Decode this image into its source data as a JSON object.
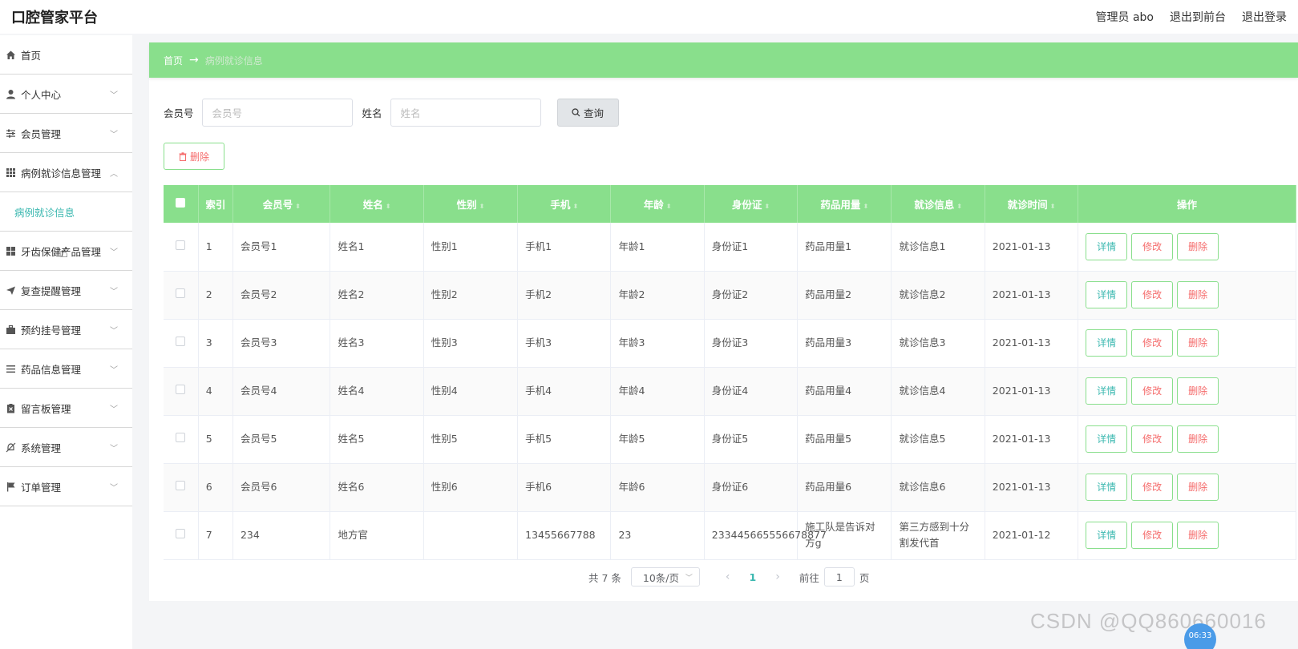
{
  "header": {
    "brand": "口腔管家平台",
    "user": "管理员 abo",
    "to_front": "退出到前台",
    "logout": "退出登录"
  },
  "sidebar": {
    "items": [
      {
        "label": "首页",
        "icon": "home-icon"
      },
      {
        "label": "个人中心",
        "icon": "user-icon"
      },
      {
        "label": "会员管理",
        "icon": "sliders-icon"
      },
      {
        "label": "病例就诊信息管理",
        "icon": "grid-icon"
      },
      {
        "label": "牙齿保健产品管理",
        "icon": "apps-icon"
      },
      {
        "label": "复查提醒管理",
        "icon": "send-icon"
      },
      {
        "label": "预约挂号管理",
        "icon": "briefcase-icon"
      },
      {
        "label": "药品信息管理",
        "icon": "list-icon"
      },
      {
        "label": "留言板管理",
        "icon": "clipboard-icon"
      },
      {
        "label": "系统管理",
        "icon": "bell-off-icon"
      },
      {
        "label": "订单管理",
        "icon": "flag-icon"
      }
    ],
    "submenu": {
      "label": "病例就诊信息"
    }
  },
  "breadcrumb": {
    "home": "首页",
    "arrow": "→",
    "current": "病例就诊信息"
  },
  "search": {
    "member_label": "会员号",
    "member_placeholder": "会员号",
    "name_label": "姓名",
    "name_placeholder": "姓名",
    "query_label": "查询"
  },
  "toolbar": {
    "delete_label": "删除"
  },
  "table": {
    "headers": [
      "索引",
      "会员号",
      "姓名",
      "性别",
      "手机",
      "年龄",
      "身份证",
      "药品用量",
      "就诊信息",
      "就诊时间",
      "操作"
    ],
    "rows": [
      [
        "1",
        "会员号1",
        "姓名1",
        "性别1",
        "手机1",
        "年龄1",
        "身份证1",
        "药品用量1",
        "就诊信息1",
        "2021-01-13"
      ],
      [
        "2",
        "会员号2",
        "姓名2",
        "性别2",
        "手机2",
        "年龄2",
        "身份证2",
        "药品用量2",
        "就诊信息2",
        "2021-01-13"
      ],
      [
        "3",
        "会员号3",
        "姓名3",
        "性别3",
        "手机3",
        "年龄3",
        "身份证3",
        "药品用量3",
        "就诊信息3",
        "2021-01-13"
      ],
      [
        "4",
        "会员号4",
        "姓名4",
        "性别4",
        "手机4",
        "年龄4",
        "身份证4",
        "药品用量4",
        "就诊信息4",
        "2021-01-13"
      ],
      [
        "5",
        "会员号5",
        "姓名5",
        "性别5",
        "手机5",
        "年龄5",
        "身份证5",
        "药品用量5",
        "就诊信息5",
        "2021-01-13"
      ],
      [
        "6",
        "会员号6",
        "姓名6",
        "性别6",
        "手机6",
        "年龄6",
        "身份证6",
        "药品用量6",
        "就诊信息6",
        "2021-01-13"
      ],
      [
        "7",
        "234",
        "地方官",
        "",
        "13455667788",
        "23",
        "233445665556678877",
        "施工队是告诉对方g",
        "第三方感到十分割发代首",
        "2021-01-12"
      ]
    ],
    "actions": {
      "view": "详情",
      "edit": "修改",
      "delete": "删除"
    }
  },
  "pagination": {
    "total": "共 7 条",
    "page_size": "10条/页",
    "current_page": "1",
    "goto_label": "前往",
    "goto_value": "1",
    "page_suffix": "页"
  },
  "overlay": {
    "watermark": "CSDN @QQ860660016",
    "time": "06:33"
  },
  "colors": {
    "accent_green": "#89df8c",
    "link_teal": "#3bb8b0",
    "danger": "#f56c6c"
  }
}
